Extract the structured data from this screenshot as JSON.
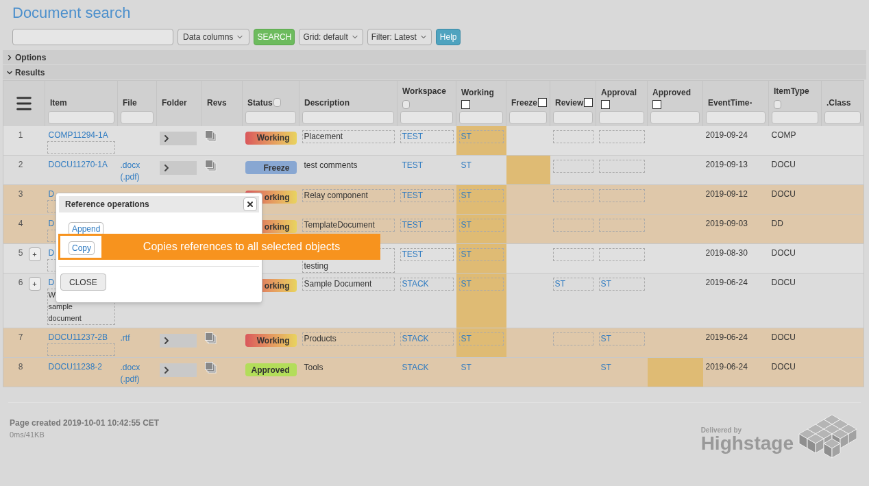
{
  "title": "Document search",
  "toolbar": {
    "data_columns": "Data columns",
    "search": "SEARCH",
    "grid": "Grid: default",
    "filter": "Filter: Latest",
    "help": "Help"
  },
  "sections": [
    {
      "label": "Options",
      "expanded": false
    },
    {
      "label": "Results",
      "expanded": true
    }
  ],
  "columns": [
    {
      "kind": "menu"
    },
    {
      "kind": "field",
      "label": "Item"
    },
    {
      "kind": "field",
      "label": "File"
    },
    {
      "kind": "label",
      "label": "Folder"
    },
    {
      "kind": "label",
      "label": "Revs"
    },
    {
      "kind": "filter-inline",
      "label": "Status"
    },
    {
      "kind": "field",
      "label": "Description"
    },
    {
      "kind": "filter",
      "label": "Workspace"
    },
    {
      "kind": "check",
      "label": "Working",
      "checked": false
    },
    {
      "kind": "check-inline",
      "label": "Freeze",
      "checked": false
    },
    {
      "kind": "check-inline",
      "label": "Review",
      "checked": false
    },
    {
      "kind": "check",
      "label": "Approval",
      "checked": false
    },
    {
      "kind": "check",
      "label": "Approved",
      "checked": false
    },
    {
      "kind": "field",
      "label": "EventTime-"
    },
    {
      "kind": "filter",
      "label": "ItemType"
    },
    {
      "kind": "field",
      "label": ".Class"
    }
  ],
  "rows": [
    {
      "selected": false,
      "number": "1",
      "item": "COMP11294-1A",
      "comment_box": true,
      "folder": true,
      "revs": true,
      "status": {
        "kind": "working",
        "text": "Working"
      },
      "desc": {
        "lines": [
          "Placement"
        ],
        "editable": true
      },
      "ws": {
        "text": "TEST",
        "editable": true
      },
      "working": {
        "text": "ST",
        "editable": true,
        "highlight": true
      },
      "freeze": {
        "highlight": false
      },
      "review": {
        "editable": true
      },
      "approval": {
        "editable": true
      },
      "approved": {
        "highlight": false
      },
      "date": "2019-09-24",
      "type": "COMP"
    },
    {
      "selected": false,
      "number": "2",
      "item": "DOCU11270-1A",
      "comment_box": false,
      "file": [
        ".docx",
        "(.pdf)"
      ],
      "folder": true,
      "revs": true,
      "status": {
        "kind": "freeze",
        "text": "Freeze"
      },
      "desc": {
        "lines": [
          "test comments"
        ],
        "editable": false
      },
      "ws": {
        "text": "TEST",
        "editable": false
      },
      "working": {
        "text": "ST",
        "editable": false,
        "highlight": false
      },
      "freeze": {
        "highlight": true
      },
      "review": {
        "editable": true
      },
      "approval": {
        "editable": true
      },
      "approved": {
        "highlight": false
      },
      "date": "2019-09-13",
      "type": "DOCU"
    },
    {
      "selected": true,
      "number": "3",
      "item": "D",
      "comment_box": true,
      "folder": false,
      "revs": false,
      "status": {
        "kind": "working",
        "text": "orking"
      },
      "desc": {
        "lines": [
          "Relay component"
        ],
        "editable": true
      },
      "ws": {
        "text": "TEST",
        "editable": true
      },
      "working": {
        "text": "ST",
        "editable": true,
        "highlight": true
      },
      "freeze": {
        "highlight": false
      },
      "review": {
        "editable": true
      },
      "approval": {
        "editable": true
      },
      "approved": {
        "highlight": false
      },
      "date": "2019-09-12",
      "type": "DOCU"
    },
    {
      "selected": true,
      "number": "4",
      "item": "D",
      "comment_box": true,
      "folder": false,
      "revs": false,
      "status": {
        "kind": "working",
        "text": "orking"
      },
      "desc": {
        "lines": [
          "TemplateDocument"
        ],
        "editable": true
      },
      "ws": {
        "text": "TEST",
        "editable": true
      },
      "working": {
        "text": "ST",
        "editable": true,
        "highlight": true
      },
      "freeze": {
        "highlight": false
      },
      "review": {
        "editable": true
      },
      "approval": {
        "editable": true
      },
      "approved": {
        "highlight": false
      },
      "date": "2019-09-03",
      "type": "DD"
    },
    {
      "selected": false,
      "number": "5",
      "expand": "+",
      "item": "D",
      "comment_box": true,
      "folder": false,
      "revs": false,
      "desc": {
        "lines": [
          "testing"
        ],
        "editable": true,
        "leading_blank_line": true
      },
      "ws": {
        "text": "TEST",
        "editable": true
      },
      "working": {
        "text": "ST",
        "editable": true,
        "highlight": true
      },
      "freeze": {
        "highlight": false
      },
      "review": {
        "editable": true
      },
      "approval": {
        "editable": true
      },
      "approved": {
        "highlight": false
      },
      "date": "2019-08-30",
      "type": "DOCU"
    },
    {
      "selected": false,
      "number": "6",
      "expand": "+",
      "item": "D",
      "comment_lines": [
        "W",
        "sample",
        "document"
      ],
      "folder": false,
      "revs": false,
      "status": {
        "kind": "working",
        "text": "orking"
      },
      "desc": {
        "lines": [
          "Sample Document"
        ],
        "editable": true
      },
      "ws": {
        "text": "STACK",
        "editable": true
      },
      "working": {
        "text": "ST",
        "editable": true,
        "highlight": true
      },
      "freeze": {
        "highlight": false
      },
      "review": {
        "text": "ST",
        "editable": true
      },
      "approval": {
        "text": "ST",
        "editable": true
      },
      "approved": {
        "highlight": false
      },
      "date": "2019-06-24",
      "type": "DOCU"
    },
    {
      "selected": true,
      "number": "7",
      "item": "DOCU11237-2B",
      "comment_box": true,
      "file": [
        ".rtf"
      ],
      "folder": true,
      "revs": true,
      "status": {
        "kind": "working",
        "text": "Working"
      },
      "desc": {
        "lines": [
          "Products"
        ],
        "editable": true
      },
      "ws": {
        "text": "STACK",
        "editable": true
      },
      "working": {
        "text": "ST",
        "editable": true,
        "highlight": true
      },
      "freeze": {
        "highlight": false
      },
      "review": {
        "editable": true
      },
      "approval": {
        "text": "ST",
        "editable": true
      },
      "approved": {
        "highlight": false
      },
      "date": "2019-06-24",
      "type": "DOCU"
    },
    {
      "selected": true,
      "number": "8",
      "item": "DOCU11238-2",
      "comment_box": false,
      "file": [
        ".docx",
        "(.pdf)"
      ],
      "folder": true,
      "revs": true,
      "status": {
        "kind": "approved",
        "text": "Approved"
      },
      "desc": {
        "lines": [
          "Tools"
        ],
        "editable": false
      },
      "ws": {
        "text": "STACK",
        "editable": false
      },
      "working": {
        "text": "ST",
        "editable": false,
        "highlight": false
      },
      "freeze": {
        "highlight": false
      },
      "review": {
        "editable": false
      },
      "approval": {
        "text": "ST",
        "editable": false
      },
      "approved": {
        "highlight": true
      },
      "date": "2019-06-24",
      "type": "DOCU"
    }
  ],
  "dialog": {
    "title": "Reference operations",
    "buttons": [
      "Append",
      "Copy"
    ],
    "close": "CLOSE"
  },
  "tooltip": {
    "text": "Copies references to all selected objects"
  },
  "footer": {
    "created": "Page created 2019-10-01 10:42:55 CET",
    "stats": "0ms/41KB",
    "delivered": "Delivered by",
    "brand": "Highstage"
  }
}
